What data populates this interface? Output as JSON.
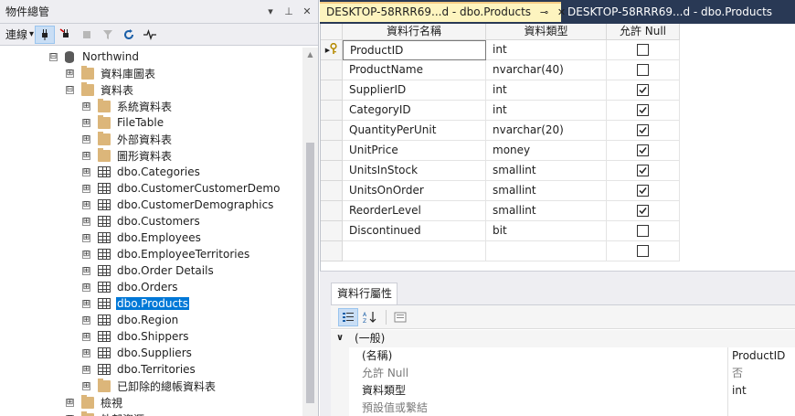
{
  "object_explorer": {
    "title": "物件總管",
    "title_buttons": [
      "▾",
      "⊥",
      "✕"
    ],
    "toolbar": {
      "connect_label": "連線",
      "connect_arrow": "▾"
    },
    "tree": [
      {
        "label": "Northwind",
        "indent": 3,
        "expander": "⊟",
        "icon": "database-icon",
        "selected": false
      },
      {
        "label": "資料庫圖表",
        "indent": 4,
        "expander": "⊞",
        "icon": "folder-icon",
        "selected": false
      },
      {
        "label": "資料表",
        "indent": 4,
        "expander": "⊟",
        "icon": "folder-icon",
        "selected": false
      },
      {
        "label": "系統資料表",
        "indent": 5,
        "expander": "⊞",
        "icon": "folder-icon",
        "selected": false
      },
      {
        "label": "FileTable",
        "indent": 5,
        "expander": "⊞",
        "icon": "folder-icon",
        "selected": false
      },
      {
        "label": "外部資料表",
        "indent": 5,
        "expander": "⊞",
        "icon": "folder-icon",
        "selected": false
      },
      {
        "label": "圖形資料表",
        "indent": 5,
        "expander": "⊞",
        "icon": "folder-icon",
        "selected": false
      },
      {
        "label": "dbo.Categories",
        "indent": 5,
        "expander": "⊞",
        "icon": "table-icon",
        "selected": false
      },
      {
        "label": "dbo.CustomerCustomerDemo",
        "indent": 5,
        "expander": "⊞",
        "icon": "table-icon",
        "selected": false
      },
      {
        "label": "dbo.CustomerDemographics",
        "indent": 5,
        "expander": "⊞",
        "icon": "table-icon",
        "selected": false
      },
      {
        "label": "dbo.Customers",
        "indent": 5,
        "expander": "⊞",
        "icon": "table-icon",
        "selected": false
      },
      {
        "label": "dbo.Employees",
        "indent": 5,
        "expander": "⊞",
        "icon": "table-icon",
        "selected": false
      },
      {
        "label": "dbo.EmployeeTerritories",
        "indent": 5,
        "expander": "⊞",
        "icon": "table-icon",
        "selected": false
      },
      {
        "label": "dbo.Order Details",
        "indent": 5,
        "expander": "⊞",
        "icon": "table-icon",
        "selected": false
      },
      {
        "label": "dbo.Orders",
        "indent": 5,
        "expander": "⊞",
        "icon": "table-icon",
        "selected": false
      },
      {
        "label": "dbo.Products",
        "indent": 5,
        "expander": "⊞",
        "icon": "table-icon",
        "selected": true
      },
      {
        "label": "dbo.Region",
        "indent": 5,
        "expander": "⊞",
        "icon": "table-icon",
        "selected": false
      },
      {
        "label": "dbo.Shippers",
        "indent": 5,
        "expander": "⊞",
        "icon": "table-icon",
        "selected": false
      },
      {
        "label": "dbo.Suppliers",
        "indent": 5,
        "expander": "⊞",
        "icon": "table-icon",
        "selected": false
      },
      {
        "label": "dbo.Territories",
        "indent": 5,
        "expander": "⊞",
        "icon": "table-icon",
        "selected": false
      },
      {
        "label": "已卸除的總帳資料表",
        "indent": 5,
        "expander": "⊞",
        "icon": "folder-icon",
        "selected": false
      },
      {
        "label": "檢視",
        "indent": 4,
        "expander": "⊞",
        "icon": "folder-icon",
        "selected": false
      },
      {
        "label": "外部資源",
        "indent": 4,
        "expander": "⊞",
        "icon": "folder-icon",
        "selected": false
      }
    ]
  },
  "tabs": [
    {
      "label": "DESKTOP-58RRR69...d - dbo.Products",
      "active": true,
      "pin": "⊸",
      "close": "✕"
    },
    {
      "label": "DESKTOP-58RRR69...d - dbo.Products",
      "active": false
    }
  ],
  "designer": {
    "headers": {
      "column_name": "資料行名稱",
      "data_type": "資料類型",
      "allow_null": "允許 Null"
    },
    "rows": [
      {
        "name": "ProductID",
        "type": "int",
        "allow_null": false,
        "primary_key": true,
        "current": true
      },
      {
        "name": "ProductName",
        "type": "nvarchar(40)",
        "allow_null": false
      },
      {
        "name": "SupplierID",
        "type": "int",
        "allow_null": true
      },
      {
        "name": "CategoryID",
        "type": "int",
        "allow_null": true
      },
      {
        "name": "QuantityPerUnit",
        "type": "nvarchar(20)",
        "allow_null": true
      },
      {
        "name": "UnitPrice",
        "type": "money",
        "allow_null": true
      },
      {
        "name": "UnitsInStock",
        "type": "smallint",
        "allow_null": true
      },
      {
        "name": "UnitsOnOrder",
        "type": "smallint",
        "allow_null": true
      },
      {
        "name": "ReorderLevel",
        "type": "smallint",
        "allow_null": true
      },
      {
        "name": "Discontinued",
        "type": "bit",
        "allow_null": false
      },
      {
        "name": "",
        "type": "",
        "allow_null": false
      }
    ]
  },
  "properties": {
    "tab_label": "資料行屬性",
    "tools": [
      "categorized-icon",
      "alphabetical-icon",
      "property-pages-icon"
    ],
    "rows": [
      {
        "kind": "category",
        "name": "(一般)",
        "value": "",
        "expander": "∨"
      },
      {
        "kind": "prop",
        "name": "(名稱)",
        "value": "ProductID"
      },
      {
        "kind": "dim",
        "name": "允許 Null",
        "value": "否"
      },
      {
        "kind": "prop",
        "name": "資料類型",
        "value": "int"
      },
      {
        "kind": "dim",
        "name": "預設值或繫結",
        "value": ""
      }
    ]
  },
  "colors": {
    "selection": "#0078d7",
    "tab_bar": "#293955",
    "active_tab": "#fdf4bf",
    "folder": "#dcb67a"
  }
}
